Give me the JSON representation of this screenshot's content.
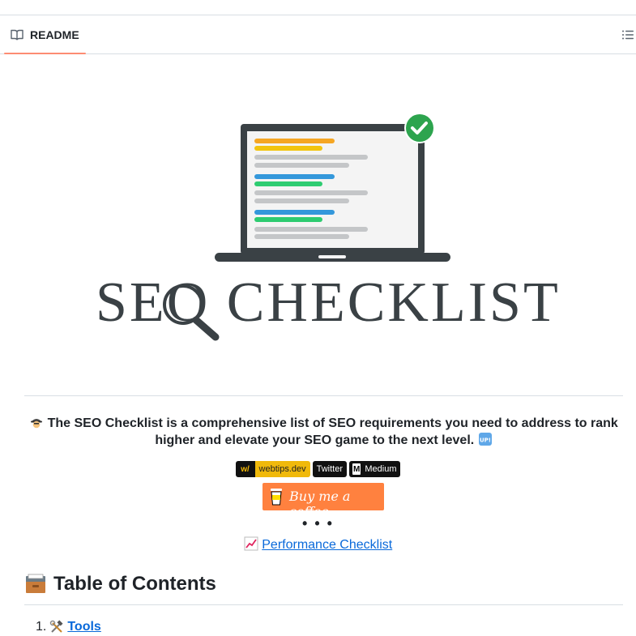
{
  "tab": {
    "label": "README",
    "icon": "book-icon"
  },
  "toc_button": {
    "icon": "list-unordered-icon"
  },
  "hero": {
    "title": "SEO CHECKLIST"
  },
  "intro": {
    "text": "The SEO Checklist is a comprehensive list of SEO requirements you need to address to rank higher and elevate your SEO game to the next level.",
    "leading_emoji": "detective-icon",
    "trailing_emoji": "up-button-icon",
    "trailing_emoji_text": "UP!"
  },
  "badges": [
    {
      "icon_text": "w/",
      "label": "webtips.dev"
    },
    {
      "label": "Twitter"
    },
    {
      "icon_text": "M",
      "label": "Medium"
    }
  ],
  "coffee_button": {
    "label": "Buy me a coffee"
  },
  "dots": "• • •",
  "performance_link": {
    "label": "Performance Checklist",
    "emoji": "chart-increasing-icon"
  },
  "toc_heading": {
    "label": "Table of Contents",
    "emoji": "card-file-box-icon"
  },
  "toc_items": [
    {
      "number": "1.",
      "label": "Tools",
      "emoji": "hammer-wrench-icon"
    }
  ],
  "colors": {
    "accent_underline": "#fd8c73",
    "link": "#0969da",
    "coffee": "#ff813f",
    "check": "#2da44e"
  }
}
